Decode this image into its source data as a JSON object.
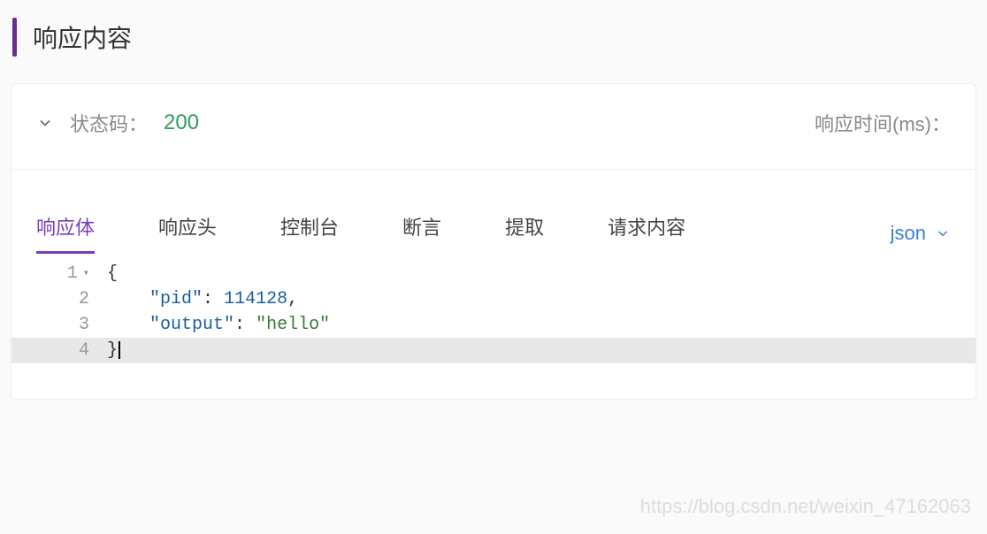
{
  "header": {
    "title": "响应内容"
  },
  "status": {
    "code_label": "状态码：",
    "code_value": "200",
    "response_time_label": "响应时间(ms)："
  },
  "tabs": {
    "items": [
      {
        "label": "响应体",
        "active": true
      },
      {
        "label": "响应头",
        "active": false
      },
      {
        "label": "控制台",
        "active": false
      },
      {
        "label": "断言",
        "active": false
      },
      {
        "label": "提取",
        "active": false
      },
      {
        "label": "请求内容",
        "active": false
      }
    ]
  },
  "format_selector": {
    "label": "json"
  },
  "code": {
    "lines": [
      {
        "num": "1",
        "content_html": "<span class='tok-punct'>{</span>",
        "fold": true
      },
      {
        "num": "2",
        "content_html": "    <span class='tok-key'>\"pid\"</span><span class='tok-punct'>:</span> <span class='tok-num'>114128</span><span class='tok-punct'>,</span>"
      },
      {
        "num": "3",
        "content_html": "    <span class='tok-key'>\"output\"</span><span class='tok-punct'>:</span> <span class='tok-str'>\"hello\"</span>"
      },
      {
        "num": "4",
        "content_html": "<span class='tok-punct'>}</span><span class='cursor-bar'></span>",
        "highlight": true
      }
    ],
    "raw": {
      "pid": 114128,
      "output": "hello"
    }
  },
  "watermark": "https://blog.csdn.net/weixin_47162063"
}
